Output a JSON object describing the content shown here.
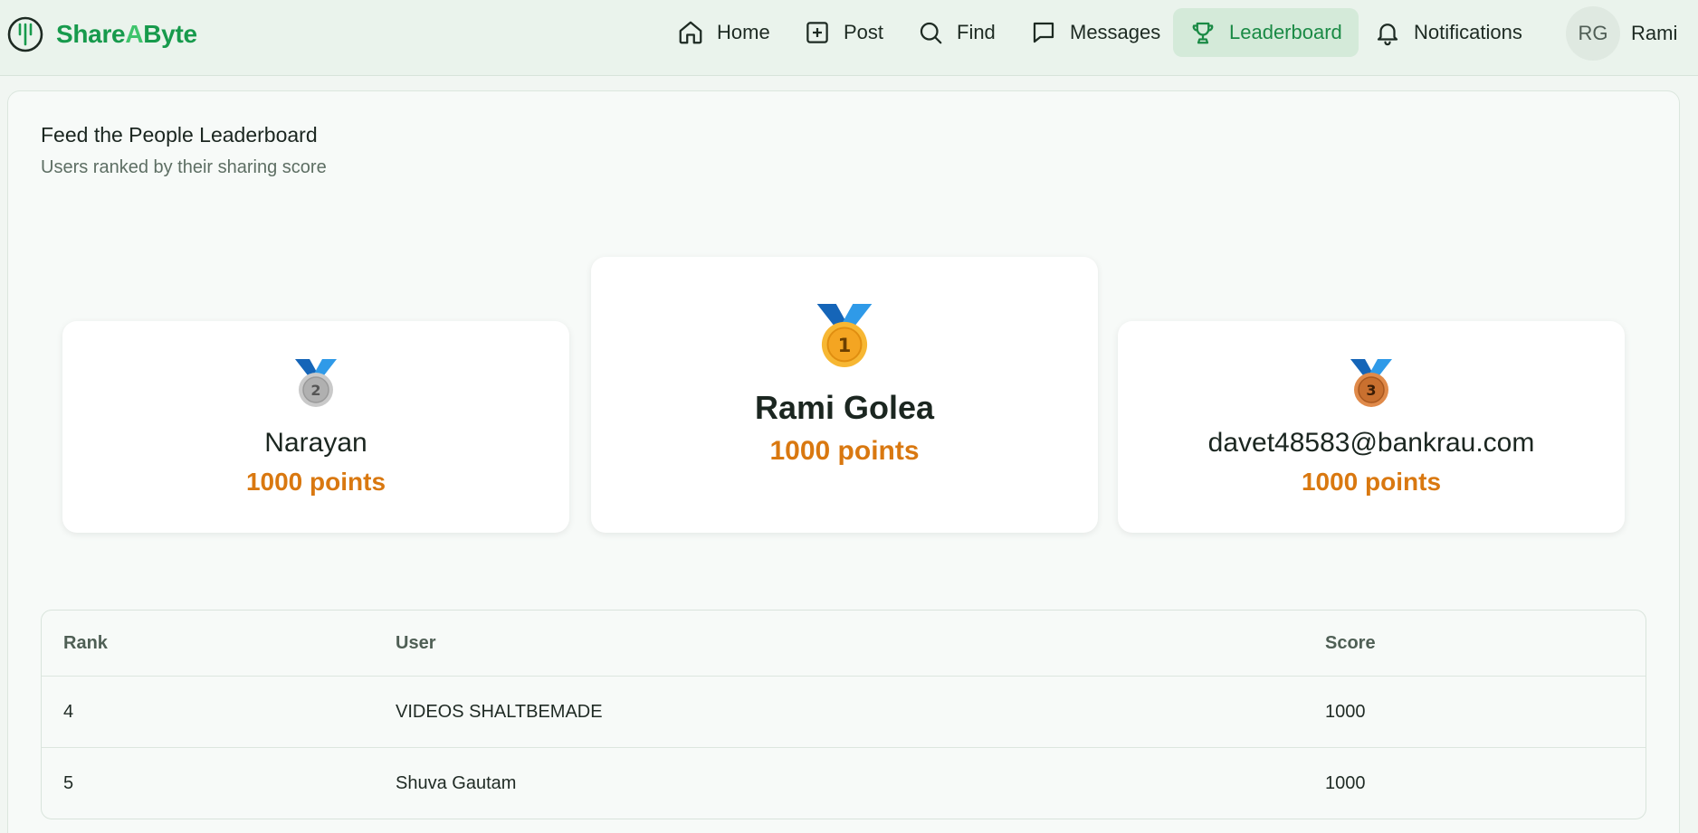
{
  "brand": {
    "name_part1": "Share",
    "name_part2": "A",
    "name_part3": "Byte"
  },
  "nav": [
    {
      "label": "Home",
      "icon": "home-icon"
    },
    {
      "label": "Post",
      "icon": "plus-square-icon"
    },
    {
      "label": "Find",
      "icon": "search-icon"
    },
    {
      "label": "Messages",
      "icon": "message-icon"
    },
    {
      "label": "Leaderboard",
      "icon": "trophy-icon",
      "active": true
    },
    {
      "label": "Notifications",
      "icon": "bell-icon"
    }
  ],
  "user": {
    "initials": "RG",
    "name": "Rami"
  },
  "page": {
    "title": "Feed the People Leaderboard",
    "subtitle": "Users ranked by their sharing score"
  },
  "podium": {
    "first": {
      "rank": "1",
      "name": "Rami Golea",
      "points": "1000 points"
    },
    "second": {
      "rank": "2",
      "name": "Narayan",
      "points": "1000 points"
    },
    "third": {
      "rank": "3",
      "name": "davet48583@bankrau.com",
      "points": "1000 points"
    }
  },
  "table": {
    "headers": {
      "rank": "Rank",
      "user": "User",
      "score": "Score"
    },
    "rows": [
      {
        "rank": "4",
        "user": "VIDEOS SHALTBEMADE",
        "score": "1000"
      },
      {
        "rank": "5",
        "user": "Shuva Gautam",
        "score": "1000"
      }
    ]
  },
  "colors": {
    "accent": "#179a4c",
    "points": "#d97810",
    "gold": "#f7b733",
    "silver": "#b8b8b8",
    "bronze": "#d1773b",
    "ribbon": "#1e7fcf"
  }
}
